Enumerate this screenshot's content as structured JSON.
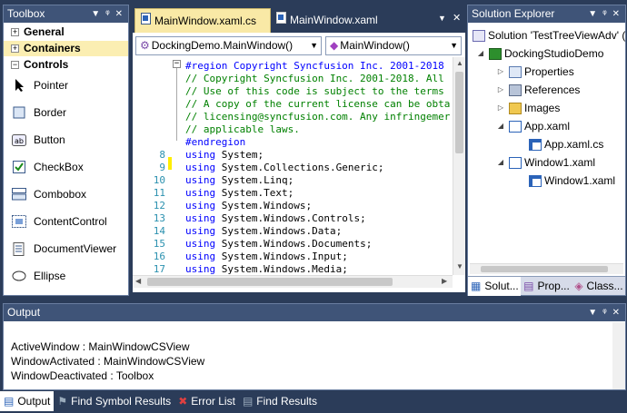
{
  "toolbox": {
    "title": "Toolbox",
    "categories": [
      {
        "label": "General",
        "state": "+"
      },
      {
        "label": "Containers",
        "state": "+"
      },
      {
        "label": "Controls",
        "state": "−"
      }
    ],
    "tools": [
      {
        "label": "Pointer",
        "icon": "pointer-icon"
      },
      {
        "label": "Border",
        "icon": "border-icon"
      },
      {
        "label": "Button",
        "icon": "button-icon"
      },
      {
        "label": "CheckBox",
        "icon": "checkbox-icon"
      },
      {
        "label": "Combobox",
        "icon": "combobox-icon"
      },
      {
        "label": "ContentControl",
        "icon": "contentcontrol-icon"
      },
      {
        "label": "DocumentViewer",
        "icon": "documentviewer-icon"
      },
      {
        "label": "Ellipse",
        "icon": "ellipse-icon"
      }
    ]
  },
  "editor": {
    "tabs": [
      {
        "label": "MainWindow.xaml.cs",
        "active": true
      },
      {
        "label": "MainWindow.xaml",
        "active": false
      }
    ],
    "class_combo": "DockingDemo.MainWindow()",
    "member_combo": "MainWindow()",
    "lines": [
      {
        "num": "",
        "text": "#region Copyright Syncfusion Inc. 2001-2018",
        "kind": "kw"
      },
      {
        "num": "",
        "text": "// Copyright Syncfusion Inc. 2001-2018. All",
        "kind": "cmt"
      },
      {
        "num": "",
        "text": "// Use of this code is subject to the terms",
        "kind": "cmt"
      },
      {
        "num": "",
        "text": "// A copy of the current license can be obta",
        "kind": "cmt"
      },
      {
        "num": "",
        "text": "// licensing@syncfusion.com. Any infringemer",
        "kind": "cmt"
      },
      {
        "num": "",
        "text": "// applicable laws.",
        "kind": "cmt"
      },
      {
        "num": "",
        "text": "#endregion",
        "kind": "kw"
      },
      {
        "num": "8",
        "text": "using System;",
        "kind": "using"
      },
      {
        "num": "9",
        "text": "using System.Collections.Generic;",
        "kind": "using"
      },
      {
        "num": "10",
        "text": "using System.Linq;",
        "kind": "using"
      },
      {
        "num": "11",
        "text": "using System.Text;",
        "kind": "using"
      },
      {
        "num": "12",
        "text": "using System.Windows;",
        "kind": "using"
      },
      {
        "num": "13",
        "text": "using System.Windows.Controls;",
        "kind": "using"
      },
      {
        "num": "14",
        "text": "using System.Windows.Data;",
        "kind": "using"
      },
      {
        "num": "15",
        "text": "using System.Windows.Documents;",
        "kind": "using"
      },
      {
        "num": "16",
        "text": "using System.Windows.Input;",
        "kind": "using"
      },
      {
        "num": "17",
        "text": "using System.Windows.Media;",
        "kind": "using"
      }
    ]
  },
  "solution_explorer": {
    "title": "Solution Explorer",
    "nodes": [
      {
        "label": "Solution 'TestTreeViewAdv' (",
        "level": 0,
        "exp": "",
        "icon": "solution-icon"
      },
      {
        "label": "DockingStudioDemo",
        "level": 1,
        "exp": "◢",
        "icon": "project-icon"
      },
      {
        "label": "Properties",
        "level": 2,
        "exp": "▷",
        "icon": "properties-icon"
      },
      {
        "label": "References",
        "level": 2,
        "exp": "▷",
        "icon": "references-icon"
      },
      {
        "label": "Images",
        "level": 2,
        "exp": "▷",
        "icon": "folder-icon"
      },
      {
        "label": "App.xaml",
        "level": 2,
        "exp": "◢",
        "icon": "xaml-icon"
      },
      {
        "label": "App.xaml.cs",
        "level": 3,
        "exp": "",
        "icon": "cs-file-icon"
      },
      {
        "label": "Window1.xaml",
        "level": 2,
        "exp": "◢",
        "icon": "xaml-icon"
      },
      {
        "label": "Window1.xaml",
        "level": 3,
        "exp": "",
        "icon": "cs-file-icon"
      }
    ],
    "bottom_tabs": [
      "Solut...",
      "Prop...",
      "Class..."
    ]
  },
  "output": {
    "title": "Output",
    "lines": [
      "ActiveWindow : MainWindowCSView",
      "WindowActivated : MainWindowCSView",
      "WindowDeactivated : Toolbox"
    ],
    "bottom_tabs": [
      "Output",
      "Find Symbol Results",
      "Error List",
      "Find Results"
    ]
  },
  "colors": {
    "frame": "#2b3c59",
    "header": "#3f5478",
    "active_tab": "#f9e9a6",
    "comment": "#008000",
    "keyword": "#0000ff",
    "line_number": "#2b91af"
  }
}
